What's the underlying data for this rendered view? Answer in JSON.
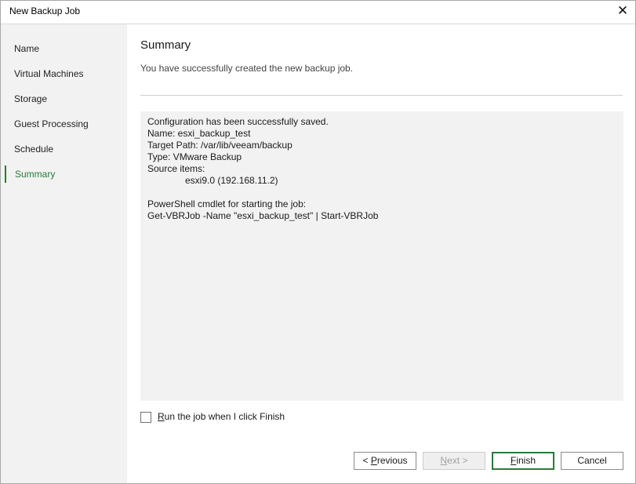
{
  "window": {
    "title": "New Backup Job",
    "close_glyph": "✕"
  },
  "sidebar": {
    "items": [
      {
        "label": "Name"
      },
      {
        "label": "Virtual Machines"
      },
      {
        "label": "Storage"
      },
      {
        "label": "Guest Processing"
      },
      {
        "label": "Schedule"
      },
      {
        "label": "Summary",
        "active": true
      }
    ]
  },
  "main": {
    "heading": "Summary",
    "subheading": "You have successfully created the new backup job.",
    "summary_lines": {
      "saved": "Configuration has been successfully saved.",
      "name": "Name: esxi_backup_test",
      "target_path": "Target Path: /var/lib/veeam/backup",
      "type": "Type: VMware Backup",
      "source_items": "Source items:",
      "source_item_1": "esxi9.0 (192.168.11.2)",
      "powershell_label": "PowerShell cmdlet for starting the job:",
      "powershell_cmd": "Get-VBRJob -Name \"esxi_backup_test\" | Start-VBRJob"
    },
    "run_job_checkbox": {
      "label_first": "R",
      "label_rest": "un the job when I click Finish",
      "checked": false
    }
  },
  "buttons": {
    "previous": {
      "prefix": "< ",
      "accel": "P",
      "rest": "revious"
    },
    "next": {
      "accel": "N",
      "rest": "ext >",
      "disabled": true
    },
    "finish": {
      "accel": "F",
      "rest": "inish"
    },
    "cancel": {
      "label": "Cancel"
    }
  },
  "colors": {
    "accent": "#2b7a3b",
    "sidebar_bg": "#f1f2f1"
  }
}
